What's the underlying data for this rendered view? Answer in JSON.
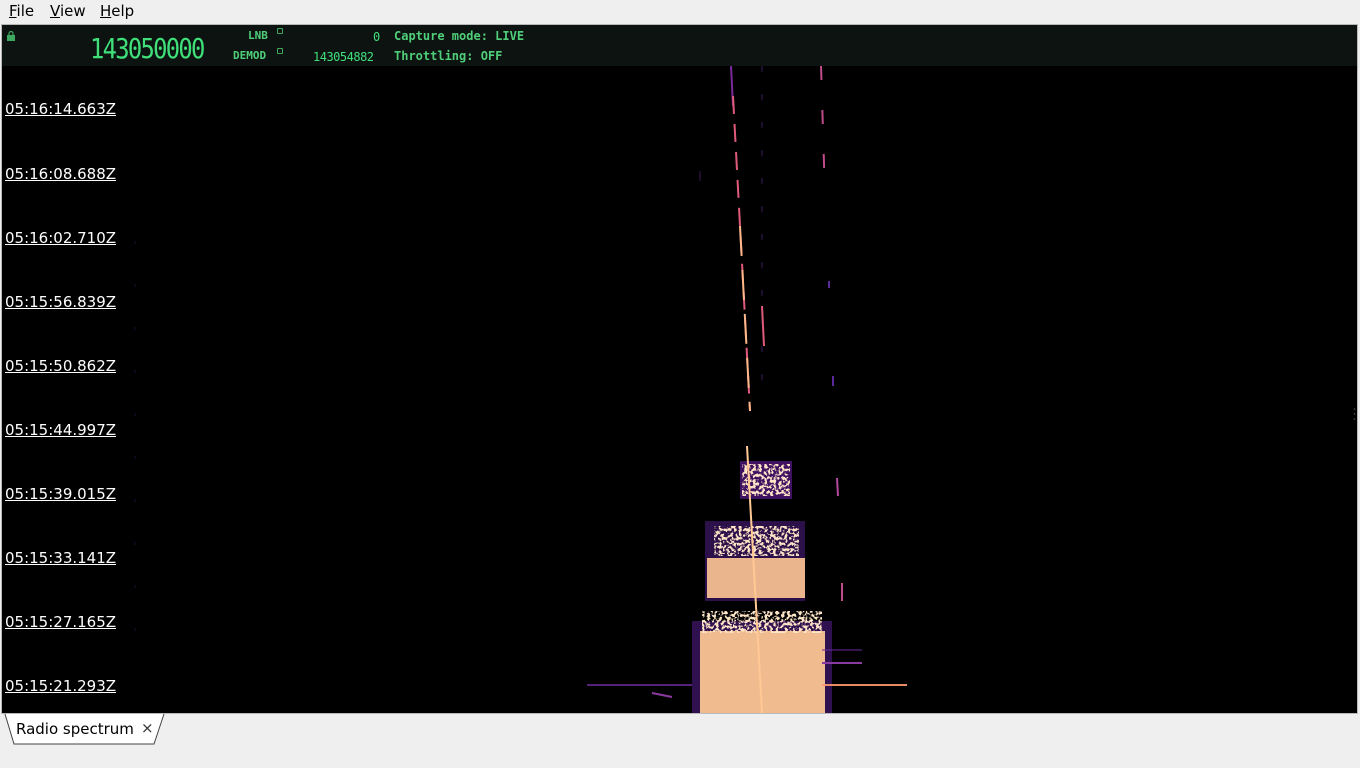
{
  "menu": {
    "items": [
      "File",
      "View",
      "Help"
    ]
  },
  "header": {
    "main_frequency": "143050000",
    "lnb_label": "LNB",
    "lnb_value": "0",
    "demod_label": "DEMOD",
    "demod_value": "143054882",
    "capture_mode": "Capture mode: LIVE",
    "throttling": "Throttling: OFF",
    "lock_icon": "padlock-icon",
    "accent_color": "#3fe07a"
  },
  "waterfall": {
    "time_labels": [
      "05:16:14.663Z",
      "05:16:08.688Z",
      "05:16:02.710Z",
      "05:15:56.839Z",
      "05:15:50.862Z",
      "05:15:44.997Z",
      "05:15:39.015Z",
      "05:15:33.141Z",
      "05:15:27.165Z",
      "05:15:21.293Z"
    ],
    "colors": {
      "background": "#000000",
      "low": "#5a1a8a",
      "mid": "#e0507a",
      "high": "#ffc894"
    }
  },
  "tabs": [
    {
      "label": "Radio spectrum",
      "close_icon": "close-icon"
    }
  ]
}
